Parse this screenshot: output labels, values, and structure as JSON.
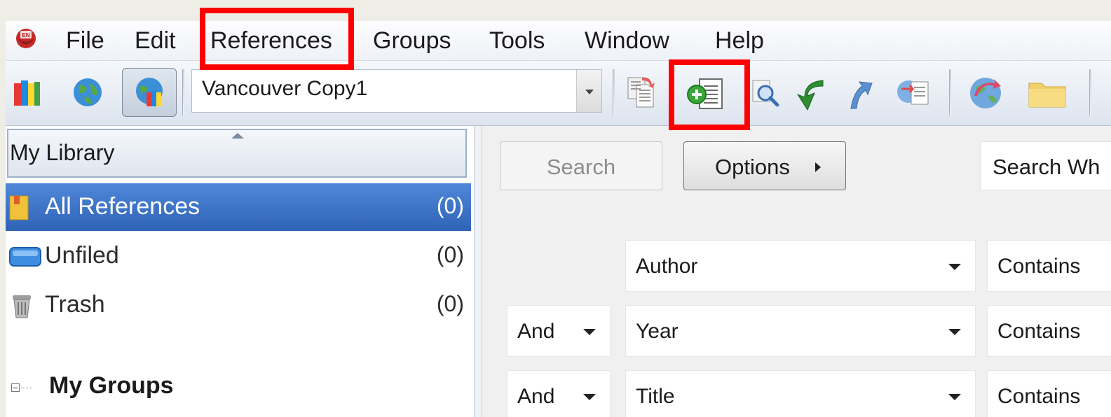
{
  "menubar": {
    "items": [
      "File",
      "Edit",
      "References",
      "Groups",
      "Tools",
      "Window",
      "Help"
    ]
  },
  "toolbar": {
    "style_value": "Vancouver Copy1",
    "icons": [
      "local-library-icon",
      "online-search-icon",
      "integrated-library-icon",
      "copy-formatted-icon",
      "new-reference-icon",
      "find-full-text-icon",
      "return-icon",
      "export-icon",
      "insert-citation-icon",
      "online-sync-icon",
      "open-folder-icon"
    ]
  },
  "library": {
    "header": "My Library",
    "items": [
      {
        "label": "All References",
        "count": "(0)",
        "selected": true
      },
      {
        "label": "Unfiled",
        "count": "(0)",
        "selected": false
      },
      {
        "label": "Trash",
        "count": "(0)",
        "selected": false
      }
    ],
    "groups_label": "My Groups"
  },
  "search": {
    "search_label": "Search",
    "options_label": "Options",
    "search_where": "Search Wh",
    "rows": [
      {
        "connector": "",
        "field": "Author",
        "operator": "Contains"
      },
      {
        "connector": "And",
        "field": "Year",
        "operator": "Contains"
      },
      {
        "connector": "And",
        "field": "Title",
        "operator": "Contains"
      }
    ]
  },
  "colors": {
    "highlight": "#ff0000",
    "selection": "#3a6fc4",
    "background": "#eeede6"
  }
}
